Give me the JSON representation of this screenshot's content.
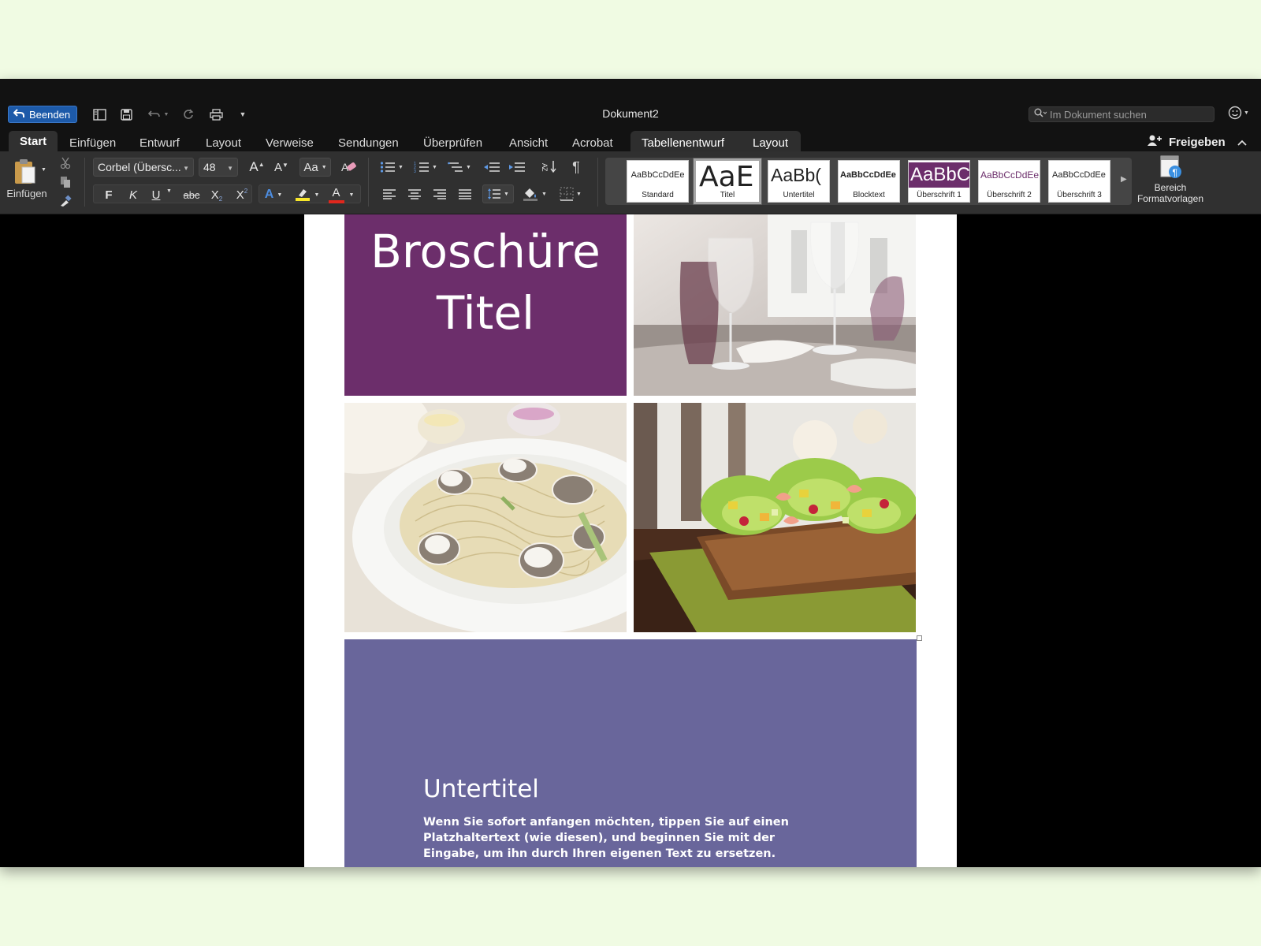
{
  "window": {
    "title": "Dokument2",
    "quit_label": "Beenden",
    "search_placeholder": "Im Dokument suchen"
  },
  "tabs": [
    {
      "label": "Start",
      "active": true
    },
    {
      "label": "Einfügen"
    },
    {
      "label": "Entwurf"
    },
    {
      "label": "Layout"
    },
    {
      "label": "Verweise"
    },
    {
      "label": "Sendungen"
    },
    {
      "label": "Überprüfen"
    },
    {
      "label": "Ansicht"
    },
    {
      "label": "Acrobat"
    },
    {
      "label": "Tabellenentwurf",
      "contextual": true
    },
    {
      "label": "Layout",
      "contextual": true
    }
  ],
  "share_label": "Freigeben",
  "ribbon": {
    "paste_label": "Einfügen",
    "font_name": "Corbel (Übersc...",
    "font_size": "48",
    "bold": "F",
    "italic": "K",
    "underline": "U",
    "strikethrough": "abc",
    "subscript": "X",
    "superscript": "X",
    "text_effects": "A",
    "font_color": "A",
    "change_case": "Aa",
    "grow_font": "A",
    "shrink_font": "A",
    "pilcrow": "¶",
    "sort": "AZ",
    "highlight_color": "#f7e62a",
    "font_color_value": "#e0271d",
    "styles_pane_label_1": "Bereich",
    "styles_pane_label_2": "Formatvorlagen"
  },
  "styles": [
    {
      "sample": "AaBbCcDdEe",
      "name": "Standard"
    },
    {
      "sample": "AaE",
      "name": "Titel",
      "selected": true
    },
    {
      "sample": "AaBb(",
      "name": "Untertitel"
    },
    {
      "sample": "AaBbCcDdEe",
      "name": "Blocktext"
    },
    {
      "sample": "AaBbC",
      "name": "Überschrift 1"
    },
    {
      "sample": "AaBbCcDdEe",
      "name": "Überschrift 2"
    },
    {
      "sample": "AaBbCcDdEe",
      "name": "Überschrift 3"
    }
  ],
  "document": {
    "title_line1": "Broschüre",
    "title_line2": "Titel",
    "subtitle": "Untertitel",
    "body": "Wenn Sie sofort anfangen möchten, tippen Sie auf einen Platzhaltertext (wie diesen), und beginnen Sie mit der Eingabe, um ihn durch Ihren eigenen Text zu ersetzen.",
    "title_block_color": "#6c2e6b",
    "bottom_block_color": "#69669b"
  }
}
